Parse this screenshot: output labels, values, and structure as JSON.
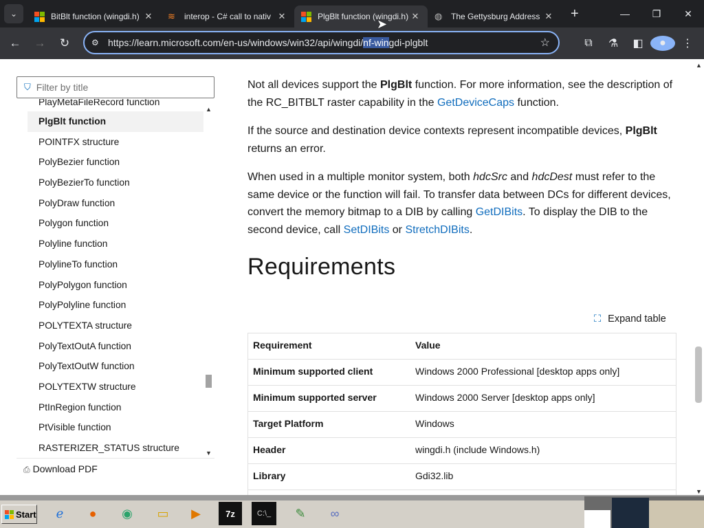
{
  "tabs": [
    {
      "title": "BitBlt function (wingdi.h)",
      "icon": "microsoft-icon"
    },
    {
      "title": "interop - C# call to nativ",
      "icon": "stackoverflow-icon"
    },
    {
      "title": "PlgBlt function (wingdi.h)",
      "icon": "microsoft-icon"
    },
    {
      "title": "The Gettysburg Address",
      "icon": "globe-icon"
    }
  ],
  "url": {
    "before": "https://learn.microsoft.com/en-us/windows/win32/api/wingdi/",
    "selected": "nf-win",
    "after": "gdi-plgblt"
  },
  "sidebar": {
    "filter_placeholder": "Filter by title",
    "cut_item": "PlayMetaFileRecord function",
    "items": [
      "PlgBlt function",
      "POINTFX structure",
      "PolyBezier function",
      "PolyBezierTo function",
      "PolyDraw function",
      "Polygon function",
      "Polyline function",
      "PolylineTo function",
      "PolyPolygon function",
      "PolyPolyline function",
      "POLYTEXTA structure",
      "PolyTextOutA function",
      "PolyTextOutW function",
      "POLYTEXTW structure",
      "PtInRegion function",
      "PtVisible function",
      "RASTERIZER_STATUS structure"
    ],
    "download": "Download PDF"
  },
  "content": {
    "p1": {
      "t1": "Not all devices support the ",
      "b1": "PlgBlt",
      "t2": " function. For more information, see the description of the RC_BITBLT raster capability in the ",
      "l1": "GetDeviceCaps",
      "t3": " function."
    },
    "p2": {
      "t1": "If the source and destination device contexts represent incompatible devices, ",
      "b1": "PlgBlt",
      "t2": " returns an error."
    },
    "p3": {
      "t1": "When used in a multiple monitor system, both ",
      "i1": "hdcSrc",
      "t2": " and ",
      "i2": "hdcDest",
      "t3": " must refer to the same device or the function will fail. To transfer data between DCs for different devices, convert the memory bitmap to a DIB by calling ",
      "l1": "GetDIBits",
      "t4": ". To display the DIB to the second device, call ",
      "l2": "SetDIBits",
      "t5": " or ",
      "l3": "StretchDIBits",
      "t6": "."
    },
    "heading": "Requirements",
    "expand": "Expand table",
    "table": {
      "headers": [
        "Requirement",
        "Value"
      ],
      "rows": [
        [
          "Minimum supported client",
          "Windows 2000 Professional [desktop apps only]"
        ],
        [
          "Minimum supported server",
          "Windows 2000 Server [desktop apps only]"
        ],
        [
          "Target Platform",
          "Windows"
        ],
        [
          "Header",
          "wingdi.h (include Windows.h)"
        ],
        [
          "Library",
          "Gdi32.lib"
        ]
      ]
    }
  },
  "taskbar": {
    "start": "Start",
    "apps": [
      "ie-icon",
      "firefox-icon",
      "chrome-icon",
      "folder-icon",
      "media-player-icon",
      "7zip-icon",
      "cmd-icon",
      "notepad-icon",
      "visual-studio-icon"
    ]
  }
}
